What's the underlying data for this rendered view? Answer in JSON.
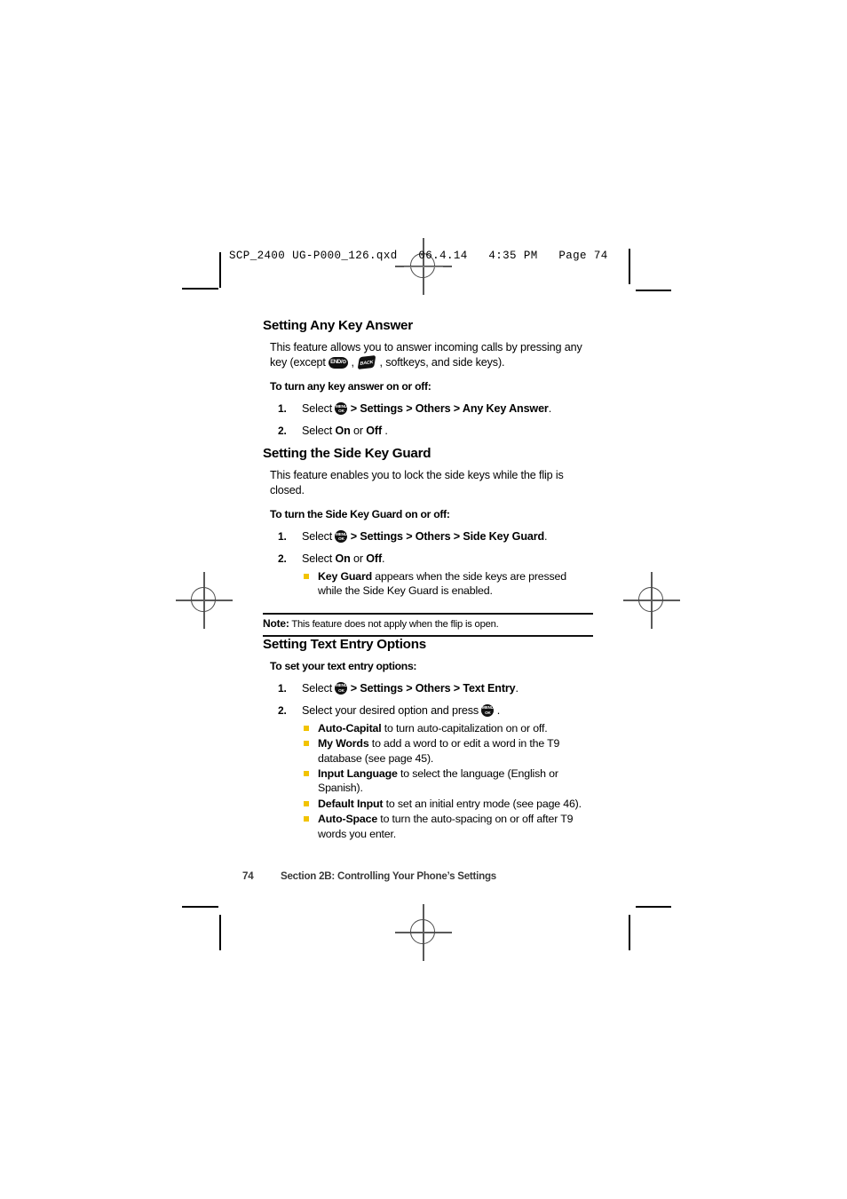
{
  "slug": {
    "text": "SCP_2400 UG-P000_126.qxd   06.4.14   4:35 PM   Page 74"
  },
  "icons": {
    "end_key": {
      "name": "end-power-key-icon",
      "label": "END/⊙"
    },
    "back_key": {
      "name": "back-key-icon",
      "label": "BACK"
    },
    "menu_ok_key": {
      "name": "menu-ok-key-icon",
      "line1": "MENU",
      "line2": "OK"
    }
  },
  "colors": {
    "bullet": "#f2c300",
    "footer_text": "#3a3a3a",
    "rule": "#111111"
  },
  "sections": [
    {
      "id": "any-key-answer",
      "heading": "Setting Any Key Answer",
      "intro_a": "This feature allows you to answer incoming calls by pressing any key (except ",
      "intro_b": " , ",
      "intro_c": " , softkeys, and side keys).",
      "lead": "To turn any key answer on or off:",
      "steps": [
        {
          "num": "1.",
          "pre": "Select ",
          "post_plain": " > ",
          "path": "Settings > Others > Any Key Answer",
          "tail": "."
        },
        {
          "num": "2.",
          "text_pre": "Select ",
          "bold_a": "On",
          "mid": " or ",
          "bold_b": "Off",
          "tail": " ."
        }
      ]
    },
    {
      "id": "side-key-guard",
      "heading": "Setting the Side Key Guard",
      "intro": "This feature enables you to lock the side keys while the flip is closed.",
      "lead": "To turn the Side Key Guard on or off:",
      "steps": [
        {
          "num": "1.",
          "pre": "Select ",
          "post_plain": " > ",
          "path": "Settings > Others > Side Key Guard",
          "tail": "."
        },
        {
          "num": "2.",
          "text_pre": "Select ",
          "bold_a": "On",
          "mid": " or ",
          "bold_b": "Off",
          "tail": ".",
          "subs": [
            {
              "bold": "Key Guard",
              "text": " appears when the side keys are pressed while the Side Key Guard is enabled."
            }
          ]
        }
      ],
      "note": {
        "label": "Note:",
        "text": " This feature does not apply when the flip is open."
      }
    },
    {
      "id": "text-entry-options",
      "heading": "Setting Text Entry Options",
      "lead": "To set your text entry options:",
      "steps": [
        {
          "num": "1.",
          "pre": "Select ",
          "post_plain": " > ",
          "path": "Settings > Others > Text Entry",
          "tail": "."
        },
        {
          "num": "2.",
          "pre": "Select your desired option and press ",
          "tail": " .",
          "subs": [
            {
              "bold": "Auto-Capital",
              "text": " to turn auto-capitalization on or off."
            },
            {
              "bold": "My Words",
              "text": " to add a word to or edit a word in the T9 database (see page 45)."
            },
            {
              "bold": "Input Language",
              "text": " to select the language (English or Spanish)."
            },
            {
              "bold": "Default Input",
              "text": " to set an initial entry mode (see page 46)."
            },
            {
              "bold": "Auto-Space",
              "text": " to turn the auto-spacing on or off after T9 words you enter."
            }
          ]
        }
      ]
    }
  ],
  "footer": {
    "page_number": "74",
    "section_title": "Section 2B: Controlling Your Phone’s Settings"
  }
}
